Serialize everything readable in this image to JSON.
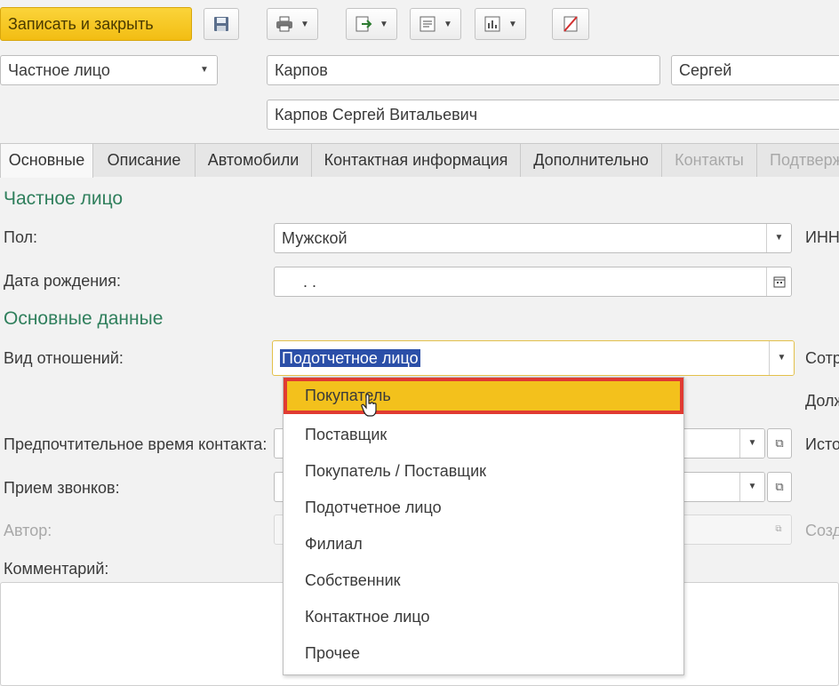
{
  "toolbar": {
    "save_close_label": "Записать и закрыть",
    "icons": [
      "save-icon",
      "print-icon",
      "goto-icon",
      "report-icon",
      "analytics-icon",
      "no-post-icon"
    ]
  },
  "header": {
    "entity_type": "Частное лицо",
    "last_name": "Карпов",
    "first_name": "Сергей",
    "full_name": "Карпов Сергей Витальевич"
  },
  "tabs": [
    {
      "label": "Основные",
      "state": "active"
    },
    {
      "label": "Описание",
      "state": "normal"
    },
    {
      "label": "Автомобили",
      "state": "normal"
    },
    {
      "label": "Контактная информация",
      "state": "normal"
    },
    {
      "label": "Дополнительно",
      "state": "normal"
    },
    {
      "label": "Контакты",
      "state": "disabled"
    },
    {
      "label": "Подтверж",
      "state": "disabled"
    }
  ],
  "sections": {
    "private_person": "Частное лицо",
    "main_data": "Основные данные"
  },
  "form": {
    "gender_label": "Пол:",
    "gender_value": "Мужской",
    "birth_label": "Дата рождения:",
    "birth_value": ". .",
    "relation_label": "Вид отношений:",
    "relation_value": "Подотчетное лицо",
    "contact_time_label": "Предпочтительное время контакта:",
    "calls_label": "Прием звонков:",
    "author_label": "Автор:",
    "comment_label": "Комментарий:"
  },
  "right_labels": {
    "inn": "ИНН",
    "employee": "Сотр",
    "position": "Долж",
    "source": "Исто",
    "created": "Созд"
  },
  "dropdown": {
    "items": [
      "Покупатель",
      "Поставщик",
      "Покупатель / Поставщик",
      "Подотчетное лицо",
      "Филиал",
      "Собственник",
      "Контактное лицо",
      "Прочее"
    ],
    "highlighted_index": 0
  },
  "colors": {
    "accent_yellow": "#f3c11c",
    "highlight_red": "#e03b32",
    "section_green": "#2f7f5c",
    "selection_blue": "#2b4fa8"
  }
}
